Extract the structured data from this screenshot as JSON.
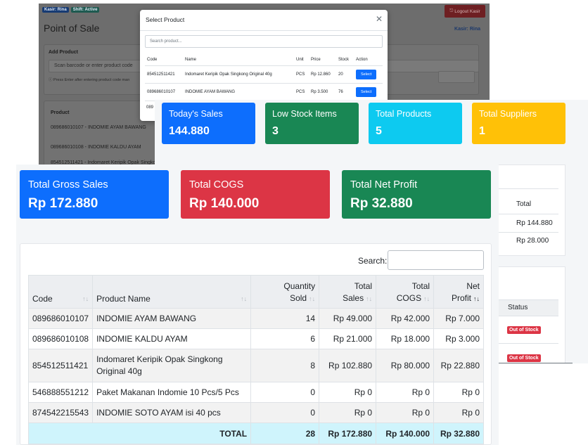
{
  "pos": {
    "badges": [
      "Kasir: Rina",
      "Shift: Active"
    ],
    "logout_label": "Logout Kasir",
    "title": "Point of Sale",
    "kasir": "Kasir: Rina",
    "add_product_label": "Add Product",
    "barcode_placeholder": "Scan barcode or enter product code",
    "barcode_hint": "ⓘ Press Enter after entering product code man",
    "cart_header": "Product",
    "cart_rows": [
      "089686010107 - INDOMIE AYAM BAWANG",
      "089686010108 - INDOMIE KALDU AYAM",
      "854512511421 - Indomaret Keripik Opak Singko"
    ]
  },
  "modal": {
    "title": "Select Product",
    "search_placeholder": "Search product...",
    "columns": [
      "Code",
      "Name",
      "Unit",
      "Price",
      "Stock",
      "Action"
    ],
    "rows": [
      {
        "code": "854512511421",
        "name": "Indomaret Keripik Opak Singkong Original 40g",
        "unit": "PCS",
        "price": "Rp 12.860",
        "stock": "20",
        "action": "Select"
      },
      {
        "code": "089686010107",
        "name": "INDOMIE AYAM BAWANG",
        "unit": "PCS",
        "price": "Rp 3.500",
        "stock": "76",
        "action": "Select"
      }
    ],
    "cut_row": "089"
  },
  "dashboard": {
    "stats": [
      {
        "title": "Today's Sales",
        "value": "144.880",
        "color": "#0d6efd"
      },
      {
        "title": "Low Stock Items",
        "value": "3",
        "color": "#198754"
      },
      {
        "title": "Total Products",
        "value": "5",
        "color": "#0dcaf0"
      },
      {
        "title": "Total Suppliers",
        "value": "1",
        "color": "#ffc107"
      }
    ],
    "total_header": "Total",
    "totals": [
      "Rp 144.880",
      "Rp 28.000"
    ],
    "status_header": "Status",
    "status_badges": [
      "Out of Stock",
      "Out of Stock"
    ]
  },
  "report": {
    "cards": [
      {
        "title": "Total Gross Sales",
        "value": "Rp 172.880",
        "color": "#0d6efd"
      },
      {
        "title": "Total COGS",
        "value": "Rp 140.000",
        "color": "#dc3545"
      },
      {
        "title": "Total Net Profit",
        "value": "Rp 32.880",
        "color": "#198754"
      }
    ],
    "search_label": "Search:",
    "columns": [
      {
        "label": "Code",
        "sort": "↑↓"
      },
      {
        "label": "Product Name",
        "sort": "↑↓"
      },
      {
        "label": "Quantity Sold",
        "sort": "↑↓"
      },
      {
        "label": "Total Sales",
        "sort": "↑↓"
      },
      {
        "label": "Total COGS",
        "sort": "↑↓"
      },
      {
        "label": "Net Profit",
        "sort": "↑↓"
      }
    ],
    "rows": [
      {
        "code": "089686010107",
        "name": "INDOMIE AYAM BAWANG",
        "qty": "14",
        "sales": "Rp 49.000",
        "cogs": "Rp 42.000",
        "profit": "Rp 7.000"
      },
      {
        "code": "089686010108",
        "name": "INDOMIE KALDU AYAM",
        "qty": "6",
        "sales": "Rp 21.000",
        "cogs": "Rp 18.000",
        "profit": "Rp 3.000"
      },
      {
        "code": "854512511421",
        "name": "Indomaret Keripik Opak Singkong Original 40g",
        "qty": "8",
        "sales": "Rp 102.880",
        "cogs": "Rp 80.000",
        "profit": "Rp 22.880"
      },
      {
        "code": "546888551212",
        "name": "Paket Makanan Indomie 10 Pcs/5 Pcs",
        "qty": "0",
        "sales": "Rp 0",
        "cogs": "Rp 0",
        "profit": "Rp 0"
      },
      {
        "code": "874542215543",
        "name": "INDOMIE SOTO AYAM isi 40 pcs",
        "qty": "0",
        "sales": "Rp 0",
        "cogs": "Rp 0",
        "profit": "Rp 0"
      }
    ],
    "total": {
      "label": "TOTAL",
      "qty": "28",
      "sales": "Rp 172.880",
      "cogs": "Rp 140.000",
      "profit": "Rp 32.880"
    }
  }
}
